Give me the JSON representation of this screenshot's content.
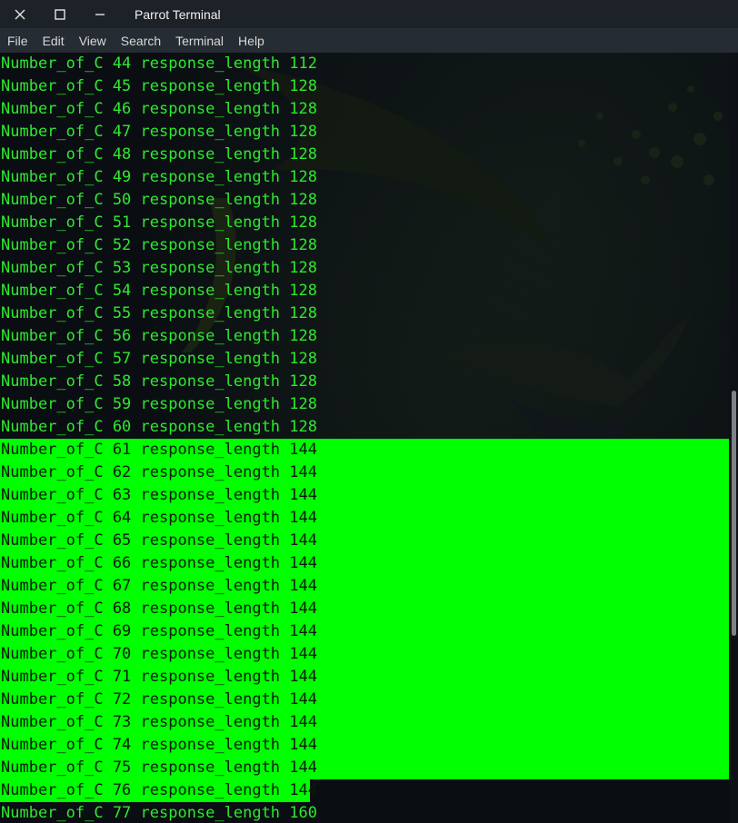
{
  "window": {
    "title": "Parrot Terminal",
    "close_icon": "close-icon",
    "maximize_icon": "maximize-icon",
    "minimize_icon": "minimize-icon"
  },
  "menu": [
    "File",
    "Edit",
    "View",
    "Search",
    "Terminal",
    "Help"
  ],
  "terminal": {
    "lines": [
      {
        "text": "Number_of_C 44 response_length 112",
        "state": "normal"
      },
      {
        "text": "Number_of_C 45 response_length 128",
        "state": "normal"
      },
      {
        "text": "Number_of_C 46 response_length 128",
        "state": "normal"
      },
      {
        "text": "Number_of_C 47 response_length 128",
        "state": "normal"
      },
      {
        "text": "Number_of_C 48 response_length 128",
        "state": "normal"
      },
      {
        "text": "Number_of_C 49 response_length 128",
        "state": "normal"
      },
      {
        "text": "Number_of_C 50 response_length 128",
        "state": "normal"
      },
      {
        "text": "Number_of_C 51 response_length 128",
        "state": "normal"
      },
      {
        "text": "Number_of_C 52 response_length 128",
        "state": "normal"
      },
      {
        "text": "Number_of_C 53 response_length 128",
        "state": "normal"
      },
      {
        "text": "Number_of_C 54 response_length 128",
        "state": "normal"
      },
      {
        "text": "Number_of_C 55 response_length 128",
        "state": "normal"
      },
      {
        "text": "Number_of_C 56 response_length 128",
        "state": "normal"
      },
      {
        "text": "Number_of_C 57 response_length 128",
        "state": "normal"
      },
      {
        "text": "Number_of_C 58 response_length 128",
        "state": "normal"
      },
      {
        "text": "Number_of_C 59 response_length 128",
        "state": "normal"
      },
      {
        "text": "Number_of_C 60 response_length 128",
        "state": "normal"
      },
      {
        "text": "Number_of_C 61 response_length 144",
        "state": "selected"
      },
      {
        "text": "Number_of_C 62 response_length 144",
        "state": "selected"
      },
      {
        "text": "Number_of_C 63 response_length 144",
        "state": "selected"
      },
      {
        "text": "Number_of_C 64 response_length 144",
        "state": "selected"
      },
      {
        "text": "Number_of_C 65 response_length 144",
        "state": "selected"
      },
      {
        "text": "Number_of_C 66 response_length 144",
        "state": "selected"
      },
      {
        "text": "Number_of_C 67 response_length 144",
        "state": "selected"
      },
      {
        "text": "Number_of_C 68 response_length 144",
        "state": "selected"
      },
      {
        "text": "Number_of_C 69 response_length 144",
        "state": "selected"
      },
      {
        "text": "Number_of_C 70 response_length 144",
        "state": "selected"
      },
      {
        "text": "Number_of_C 71 response_length 144",
        "state": "selected"
      },
      {
        "text": "Number_of_C 72 response_length 144",
        "state": "selected"
      },
      {
        "text": "Number_of_C 73 response_length 144",
        "state": "selected"
      },
      {
        "text": "Number_of_C 74 response_length 144",
        "state": "selected"
      },
      {
        "text": "Number_of_C 75 response_length 144",
        "state": "selected"
      },
      {
        "text": "Number_of_C 76 response_length 144",
        "state": "selected-partial"
      },
      {
        "text": "Number_of_C 77 response_length 160",
        "state": "normal"
      }
    ]
  },
  "colors": {
    "text": "#2ee82e",
    "selection": "#00ff00",
    "background": "#0a0e12",
    "titlebar": "#1d2229",
    "menubar": "#262c33"
  }
}
